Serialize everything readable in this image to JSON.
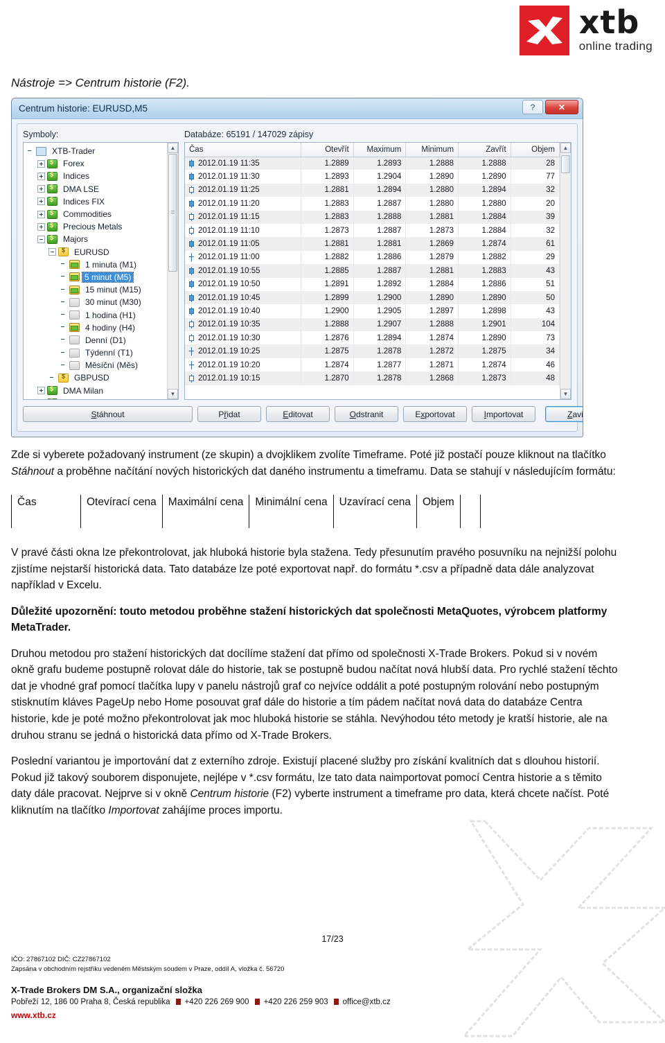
{
  "brand": {
    "logo_name": "xtb-logo",
    "wordmark": "xtb",
    "tagline": "online trading",
    "logo_red": "#e01f26"
  },
  "intro": {
    "line": "Nástroje => Centrum historie (F2)."
  },
  "dialog": {
    "title": "Centrum historie: EURUSD,M5",
    "help_button": "?",
    "close_button": "✕",
    "symbols_label": "Symboly:",
    "database_label": "Databáze: 65191 / 147029 zápisy",
    "tree": [
      {
        "label": "XTB-Trader",
        "depth": 0,
        "icon": "root-icon",
        "expander": "none",
        "selected": false
      },
      {
        "label": "Forex",
        "depth": 1,
        "icon": "group-icon",
        "expander": "plus",
        "selected": false
      },
      {
        "label": "Indices",
        "depth": 1,
        "icon": "group-icon",
        "expander": "plus",
        "selected": false
      },
      {
        "label": "DMA LSE",
        "depth": 1,
        "icon": "group-icon",
        "expander": "plus",
        "selected": false
      },
      {
        "label": "Indices FIX",
        "depth": 1,
        "icon": "group-icon",
        "expander": "plus",
        "selected": false
      },
      {
        "label": "Commodities",
        "depth": 1,
        "icon": "group-icon",
        "expander": "plus",
        "selected": false
      },
      {
        "label": "Precious Metals",
        "depth": 1,
        "icon": "group-icon",
        "expander": "plus",
        "selected": false
      },
      {
        "label": "Majors",
        "depth": 1,
        "icon": "group-icon",
        "expander": "minus",
        "selected": false
      },
      {
        "label": "EURUSD",
        "depth": 2,
        "icon": "symbol-icon",
        "expander": "minus",
        "selected": false
      },
      {
        "label": "1 minuta (M1)",
        "depth": 3,
        "icon": "timeframe-loaded-icon",
        "expander": "none",
        "selected": false
      },
      {
        "label": "5 minut (M5)",
        "depth": 3,
        "icon": "timeframe-loaded-icon",
        "expander": "none",
        "selected": true
      },
      {
        "label": "15 minut (M15)",
        "depth": 3,
        "icon": "timeframe-loaded-icon",
        "expander": "none",
        "selected": false
      },
      {
        "label": "30 minut (M30)",
        "depth": 3,
        "icon": "timeframe-empty-icon",
        "expander": "none",
        "selected": false
      },
      {
        "label": "1 hodina (H1)",
        "depth": 3,
        "icon": "timeframe-empty-icon",
        "expander": "none",
        "selected": false
      },
      {
        "label": "4 hodiny (H4)",
        "depth": 3,
        "icon": "timeframe-loaded-icon",
        "expander": "none",
        "selected": false
      },
      {
        "label": "Denní (D1)",
        "depth": 3,
        "icon": "timeframe-empty-icon",
        "expander": "none",
        "selected": false
      },
      {
        "label": "Týdenní (T1)",
        "depth": 3,
        "icon": "timeframe-empty-icon",
        "expander": "none",
        "selected": false
      },
      {
        "label": "Měsíční (Měs)",
        "depth": 3,
        "icon": "timeframe-empty-icon",
        "expander": "none",
        "selected": false
      },
      {
        "label": "GBPUSD",
        "depth": 2,
        "icon": "symbol-icon",
        "expander": "none",
        "selected": false
      },
      {
        "label": "DMA Milan",
        "depth": 1,
        "icon": "group-icon",
        "expander": "plus",
        "selected": false
      },
      {
        "label": "CFD Margin",
        "depth": 1,
        "icon": "group-icon",
        "expander": "plus",
        "selected": false
      }
    ],
    "grid_columns": [
      "Čas",
      "Otevřít",
      "Maximum",
      "Minimum",
      "Zavřít",
      "Objem"
    ],
    "grid_rows": [
      {
        "candle": "filled",
        "time": "2012.01.19 11:35",
        "open": "1.2889",
        "high": "1.2893",
        "low": "1.2888",
        "close": "1.2888",
        "volume": "28"
      },
      {
        "candle": "filled",
        "time": "2012.01.19 11:30",
        "open": "1.2893",
        "high": "1.2904",
        "low": "1.2890",
        "close": "1.2890",
        "volume": "77"
      },
      {
        "candle": "hollow",
        "time": "2012.01.19 11:25",
        "open": "1.2881",
        "high": "1.2894",
        "low": "1.2880",
        "close": "1.2894",
        "volume": "32"
      },
      {
        "candle": "filled",
        "time": "2012.01.19 11:20",
        "open": "1.2883",
        "high": "1.2887",
        "low": "1.2880",
        "close": "1.2880",
        "volume": "20"
      },
      {
        "candle": "hollow",
        "time": "2012.01.19 11:15",
        "open": "1.2883",
        "high": "1.2888",
        "low": "1.2881",
        "close": "1.2884",
        "volume": "39"
      },
      {
        "candle": "hollow",
        "time": "2012.01.19 11:10",
        "open": "1.2873",
        "high": "1.2887",
        "low": "1.2873",
        "close": "1.2884",
        "volume": "32"
      },
      {
        "candle": "filled",
        "time": "2012.01.19 11:05",
        "open": "1.2881",
        "high": "1.2881",
        "low": "1.2869",
        "close": "1.2874",
        "volume": "61"
      },
      {
        "candle": "doji",
        "time": "2012.01.19 11:00",
        "open": "1.2882",
        "high": "1.2886",
        "low": "1.2879",
        "close": "1.2882",
        "volume": "29"
      },
      {
        "candle": "filled",
        "time": "2012.01.19 10:55",
        "open": "1.2885",
        "high": "1.2887",
        "low": "1.2881",
        "close": "1.2883",
        "volume": "43"
      },
      {
        "candle": "filled",
        "time": "2012.01.19 10:50",
        "open": "1.2891",
        "high": "1.2892",
        "low": "1.2884",
        "close": "1.2886",
        "volume": "51"
      },
      {
        "candle": "filled",
        "time": "2012.01.19 10:45",
        "open": "1.2899",
        "high": "1.2900",
        "low": "1.2890",
        "close": "1.2890",
        "volume": "50"
      },
      {
        "candle": "filled",
        "time": "2012.01.19 10:40",
        "open": "1.2900",
        "high": "1.2905",
        "low": "1.2897",
        "close": "1.2898",
        "volume": "43"
      },
      {
        "candle": "hollow",
        "time": "2012.01.19 10:35",
        "open": "1.2888",
        "high": "1.2907",
        "low": "1.2888",
        "close": "1.2901",
        "volume": "104"
      },
      {
        "candle": "hollow",
        "time": "2012.01.19 10:30",
        "open": "1.2876",
        "high": "1.2894",
        "low": "1.2874",
        "close": "1.2890",
        "volume": "73"
      },
      {
        "candle": "doji",
        "time": "2012.01.19 10:25",
        "open": "1.2875",
        "high": "1.2878",
        "low": "1.2872",
        "close": "1.2875",
        "volume": "34"
      },
      {
        "candle": "doji",
        "time": "2012.01.19 10:20",
        "open": "1.2874",
        "high": "1.2877",
        "low": "1.2871",
        "close": "1.2874",
        "volume": "46"
      },
      {
        "candle": "hollow",
        "time": "2012.01.19 10:15",
        "open": "1.2870",
        "high": "1.2878",
        "low": "1.2868",
        "close": "1.2873",
        "volume": "48"
      }
    ],
    "buttons": [
      {
        "name": "download",
        "label": "Stáhnout",
        "accel": "S",
        "kind": "wide"
      },
      {
        "name": "add",
        "label": "Přidat",
        "accel": "ř",
        "kind": "normal"
      },
      {
        "name": "edit",
        "label": "Editovat",
        "accel": "E",
        "kind": "normal"
      },
      {
        "name": "delete",
        "label": "Odstranit",
        "accel": "O",
        "kind": "normal"
      },
      {
        "name": "export",
        "label": "Exportovat",
        "accel": "x",
        "kind": "normal"
      },
      {
        "name": "import",
        "label": "Importovat",
        "accel": "I",
        "kind": "normal"
      },
      {
        "name": "close",
        "label": "Zavřít",
        "accel": "Z",
        "kind": "default"
      }
    ]
  },
  "doc": {
    "para1_a": "Zde si vyberete požadovaný instrument (ze skupin) a dvojklikem zvolíte Timeframe. Poté již postačí pouze kliknout na tlačítko ",
    "para1_em": "Stáhnout",
    "para1_b": " a proběhne načítání nových historických dat daného instrumentu a timeframu. Data se stahují v následujícím formátu:",
    "format_columns": [
      "Čas",
      "Otevírací cena",
      "Maximální cena",
      "Minimální cena",
      "Uzavírací cena",
      "Objem"
    ],
    "para2": "V pravé části okna lze překontrolovat, jak hluboká historie byla stažena. Tedy přesunutím pravého posuvníku na nejnižší polohu zjistíme nejstarší historická data. Tato databáze lze poté exportovat např. do formátu *.csv a případně data dále analyzovat například v Excelu.",
    "para3_bold": "Důležité upozornění: touto metodou proběhne stažení historických dat společnosti MetaQuotes, výrobcem platformy MetaTrader.",
    "para4": "Druhou metodou pro stažení historických dat docílíme stažení dat přímo od společnosti X-Trade Brokers. Pokud si v novém okně grafu budeme postupně rolovat dále do historie, tak se postupně budou načítat nová hlubší data. Pro rychlé stažení těchto dat je vhodné graf pomocí tlačítka lupy v panelu nástrojů graf co nejvíce oddálit a poté postupným rolování nebo postupným stisknutím kláves PageUp nebo Home posouvat graf dále do historie a tím pádem načítat nová data do databáze Centra historie, kde je poté možno překontrolovat jak moc hluboká historie se stáhla. Nevýhodou této metody je kratší historie, ale na druhou stranu se jedná o historická data přímo od X-Trade Brokers.",
    "para5_a": "Poslední variantou je importování dat z externího zdroje. Existují placené služby pro získání kvalitních dat s dlouhou historií. Pokud již takový souborem disponujete, nejlépe v *.csv formátu, lze tato data naimportovat pomocí Centra historie a s těmito daty dále pracovat. Nejprve si v okně ",
    "para5_em1": "Centrum historie",
    "para5_b": " (F2) vyberte instrument a timeframe pro data, která chcete načíst. Poté kliknutím na tlačítko ",
    "para5_em2": "Importovat",
    "para5_c": " zahájíme proces importu."
  },
  "footer": {
    "page_number": "17/23",
    "ids": "IČO: 27867102 DIČ: CZ27867102",
    "registry": "Zapsána v obchodním rejstříku vedeném Městským soudem v Praze, oddíl A, vložka č. 56720",
    "company": "X-Trade Brokers DM S.A., organizační složka",
    "address": "Pobřeží 12, 186 00 Praha 8, Česká republika",
    "phone1": "+420 226 269 900",
    "phone2": "+420 226 259 903",
    "email": "office@xtb.cz",
    "web": "www.xtb.cz",
    "web_color": "#cc0000"
  }
}
